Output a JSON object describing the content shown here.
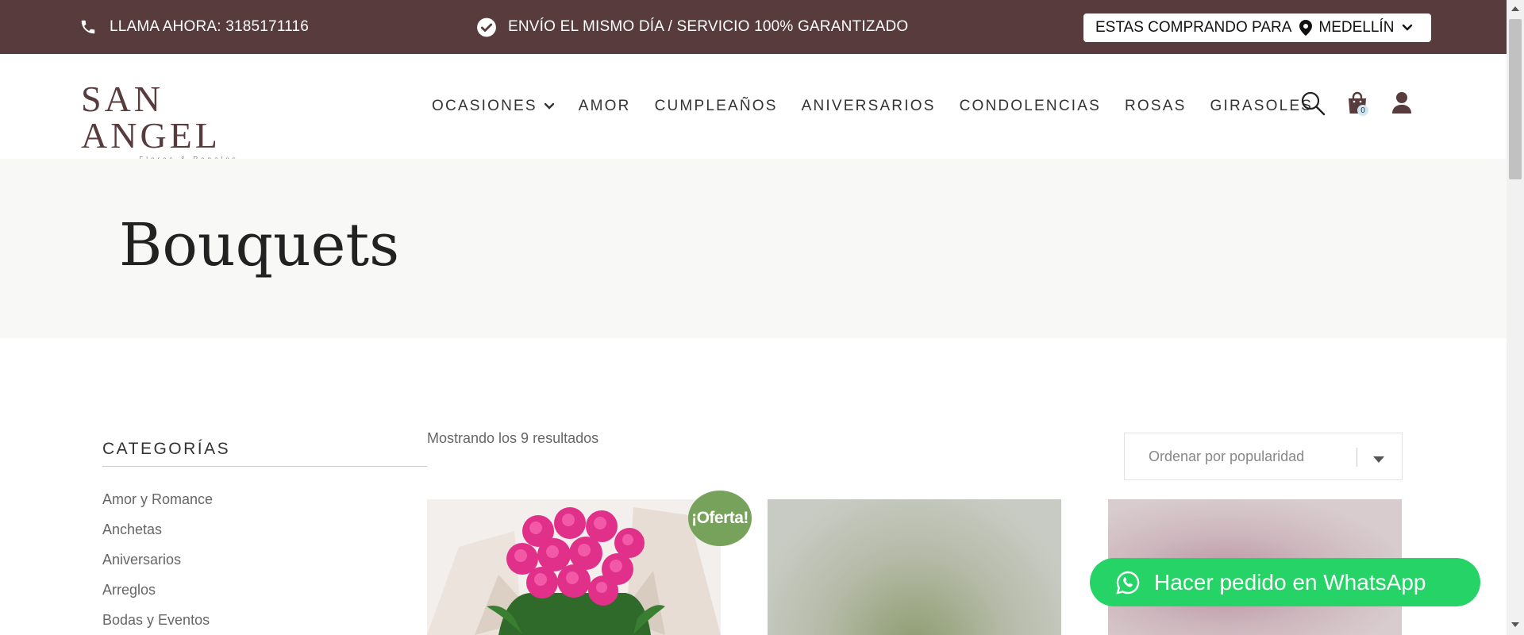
{
  "topbar": {
    "phone_label": "LLAMA AHORA: 3185171116",
    "phone_icon": "phone-icon",
    "shipping_label": "ENVÍO EL MISMO DÍA / SERVICIO 100% GARANTIZADO",
    "shipping_icon": "check-circle-icon",
    "buying_for_label": "ESTAS COMPRANDO PARA",
    "city": "MEDELLÍN",
    "bg_color": "#573b3d"
  },
  "header": {
    "brand": "SAN ANGEL",
    "brand_tagline": "Flores & Regalos",
    "nav": [
      {
        "label": "OCASIONES",
        "has_dropdown": true
      },
      {
        "label": "AMOR"
      },
      {
        "label": "CUMPLEAÑOS"
      },
      {
        "label": "ANIVERSARIOS"
      },
      {
        "label": "CONDOLENCIAS"
      },
      {
        "label": "ROSAS"
      },
      {
        "label": "GIRASOLES"
      }
    ],
    "cart_count": "0"
  },
  "hero": {
    "title": "Bouquets"
  },
  "sidebar": {
    "title": "CATEGORÍAS",
    "categories": [
      "Amor y Romance",
      "Anchetas",
      "Aniversarios",
      "Arreglos",
      "Bodas y Eventos"
    ]
  },
  "shop": {
    "results_text": "Mostrando los 9 resultados",
    "sort_selected": "Ordenar por popularidad",
    "sale_badge": "¡Oferta!"
  },
  "whatsapp": {
    "label": "Hacer pedido en WhatsApp",
    "color": "#25d366"
  }
}
